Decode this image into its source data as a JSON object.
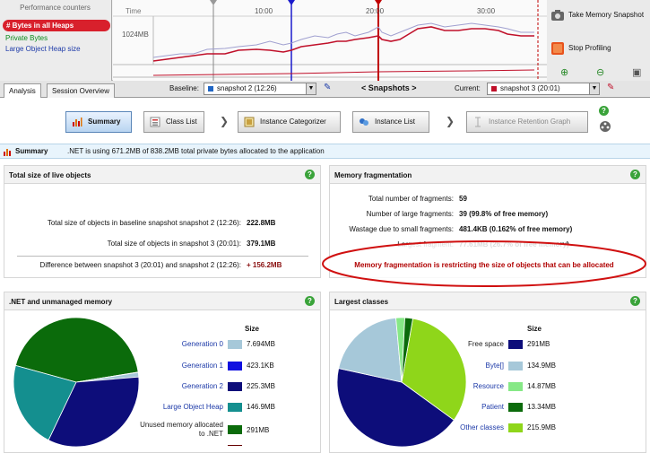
{
  "counters": {
    "header": "Performance counters",
    "items": [
      "# Bytes in all Heaps",
      "Private Bytes",
      "Large Object Heap size"
    ]
  },
  "timeline": {
    "time_label": "Time",
    "ticks": [
      "10:00",
      "20:00",
      "30:00"
    ],
    "y_label": "1024MB"
  },
  "side_buttons": {
    "take_snapshot": "Take Memory Snapshot",
    "stop_profiling": "Stop Profiling"
  },
  "tabs": [
    "Analysis",
    "Session Overview"
  ],
  "snapbar": {
    "baseline_label": "Baseline:",
    "baseline_value": "snapshot 2 (12:26)",
    "snapshots_label": "< Snapshots >",
    "current_label": "Current:",
    "current_value": "snapshot 3 (20:01)"
  },
  "nav": {
    "summary": "Summary",
    "class_list": "Class List",
    "instance_categorizer": "Instance Categorizer",
    "instance_list": "Instance List",
    "instance_retention_graph": "Instance Retention Graph"
  },
  "summary_bar": {
    "title": "Summary",
    "message": ".NET is using 671.2MB of 838.2MB total private bytes allocated to the application"
  },
  "live": {
    "title": "Total size of live objects",
    "baseline_label": "Total size of objects in baseline snapshot snapshot 2 (12:26):",
    "baseline_value": "222.8MB",
    "current_label": "Total size of objects in snapshot 3 (20:01):",
    "current_value": "379.1MB",
    "diff_label": "Difference between snapshot 3 (20:01) and snapshot 2 (12:26):",
    "diff_value": "+ 156.2MB"
  },
  "frag": {
    "title": "Memory fragmentation",
    "rows": [
      {
        "label": "Total number of fragments:",
        "value": "59"
      },
      {
        "label": "Number of large fragments:",
        "value": "39 (99.8% of free memory)"
      },
      {
        "label": "Wastage due to small fragments:",
        "value": "481.4KB (0.162% of free memory)"
      },
      {
        "label": "Largest fragment:",
        "value": "77.61MB (26.7% of free memory)"
      }
    ],
    "warning": "Memory fragmentation is restricting the size of objects that can be allocated"
  },
  "dotnet": {
    "title": ".NET and unmanaged memory",
    "size_header": "Size",
    "items": [
      {
        "label": "Generation 0",
        "value": "7.694MB",
        "color": "#a6c8d9"
      },
      {
        "label": "Generation 1",
        "value": "423.1KB",
        "color": "#1010e0"
      },
      {
        "label": "Generation 2",
        "value": "225.3MB",
        "color": "#0d0d7a"
      },
      {
        "label": "Large Object Heap",
        "value": "146.9MB",
        "color": "#148f8f"
      },
      {
        "label": "Unused memory allocated to .NET",
        "value": "291MB",
        "color": "#0b6b0b"
      }
    ]
  },
  "classes": {
    "title": "Largest classes",
    "size_header": "Size",
    "items": [
      {
        "label": "Free space",
        "value": "291MB",
        "color": "#0d0d7a"
      },
      {
        "label": "Byte[]",
        "value": "134.9MB",
        "color": "#a6c8d9"
      },
      {
        "label": "Resource",
        "value": "14.87MB",
        "color": "#86e886"
      },
      {
        "label": "Patient",
        "value": "13.34MB",
        "color": "#0b6b0b"
      },
      {
        "label": "Other classes",
        "value": "215.9MB",
        "color": "#8fd61a"
      }
    ]
  }
}
